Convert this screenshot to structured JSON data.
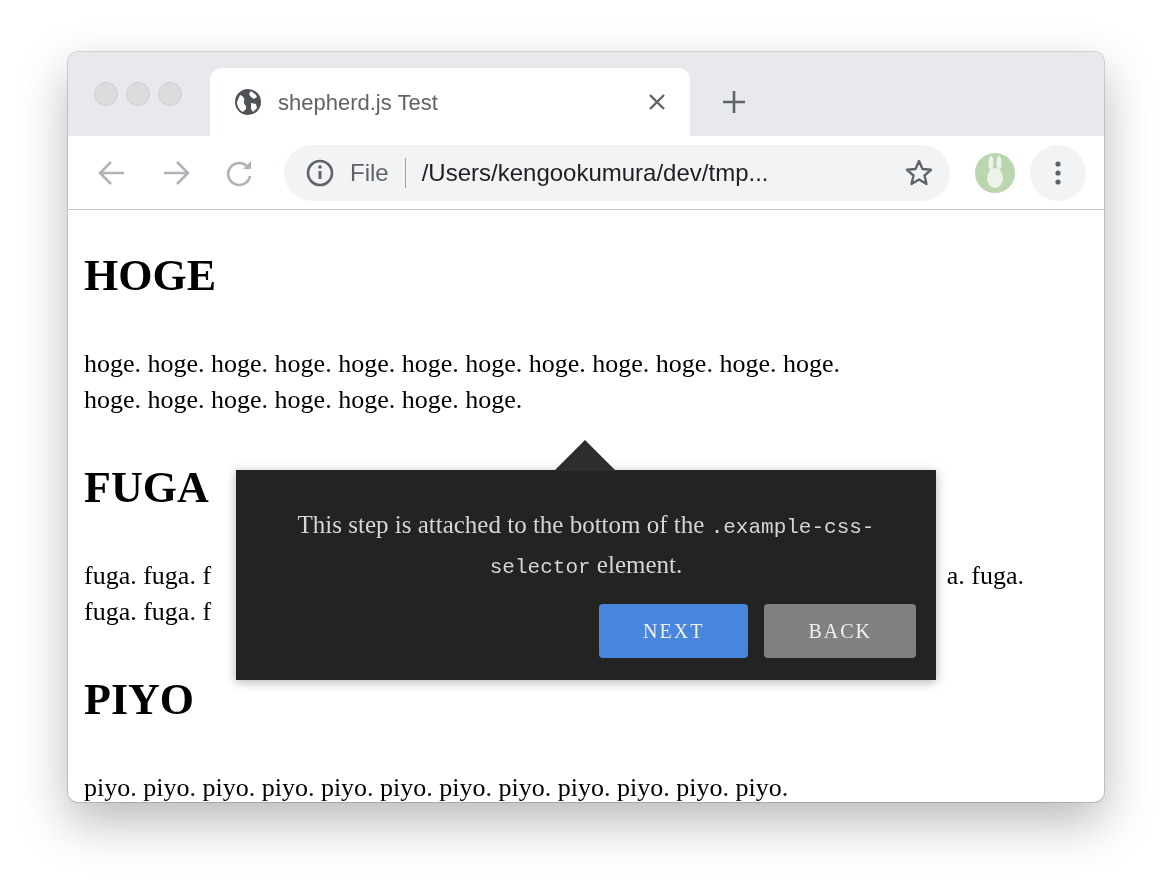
{
  "window": {
    "tab": {
      "title": "shepherd.js Test",
      "selected": true
    },
    "address_bar": {
      "scheme": "File",
      "url": "/Users/kengookumura/dev/tmp..."
    }
  },
  "page": {
    "sections": [
      {
        "heading": "HOGE",
        "lines": [
          {
            "left": "hoge. hoge. hoge. hoge. hoge. hoge. hoge. hoge. hoge. hoge. hoge. hoge."
          },
          {
            "left": "hoge. hoge. hoge. hoge. hoge. hoge. hoge."
          }
        ]
      },
      {
        "heading": "FUGA",
        "lines": [
          {
            "left": "fuga. fuga. f",
            "right": "a. fuga."
          },
          {
            "left": "fuga. fuga. f"
          }
        ]
      },
      {
        "heading": "PIYO",
        "lines": [
          {
            "left": "piyo. piyo. piyo. piyo. piyo. piyo. piyo. piyo. piyo. piyo. piyo. piyo."
          }
        ]
      }
    ]
  },
  "tour_step": {
    "text": [
      {
        "kind": "text",
        "text": "This step is attached to the bottom of the "
      },
      {
        "kind": "code",
        "text": ".example-css-selector"
      },
      {
        "kind": "text",
        "text": " element."
      }
    ],
    "buttons": [
      {
        "label": "NEXT",
        "kind": "primary"
      },
      {
        "label": "BACK",
        "kind": "secondary"
      }
    ]
  }
}
